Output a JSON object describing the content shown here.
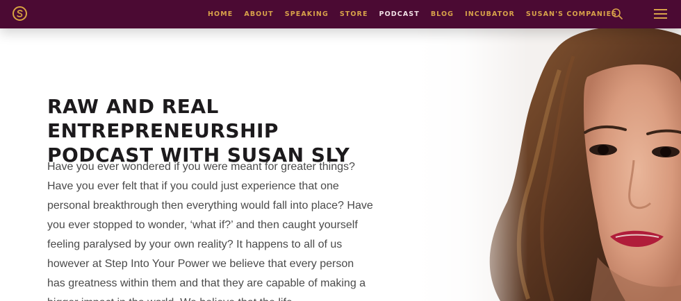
{
  "nav": {
    "logo_icon": "circle-s-logo-icon",
    "items": [
      {
        "label": "HOME",
        "active": false
      },
      {
        "label": "ABOUT",
        "active": false
      },
      {
        "label": "SPEAKING",
        "active": false
      },
      {
        "label": "STORE",
        "active": false
      },
      {
        "label": "PODCAST",
        "active": true
      },
      {
        "label": "BLOG",
        "active": false
      },
      {
        "label": "INCUBATOR",
        "active": false
      },
      {
        "label": "SUSAN'S COMPANIES",
        "active": false
      }
    ],
    "search_icon": "search-icon",
    "menu_icon": "hamburger-menu-icon"
  },
  "hero": {
    "title_line1": "RAW AND REAL ENTREPRENEURSHIP",
    "title_line2": "PODCAST WITH SUSAN SLY",
    "paragraph": "Have you ever wondered if you were meant for greater things? Have you ever felt that if you could just experience that one personal breakthrough then everything would fall into place? Have you ever stopped to wonder, ‘what if?’ and then caught yourself feeling paralysed by your own reality? It happens to all of us however at Step Into Your Power we believe that every person has greatness within them and that they are capable of making a bigger impact in the world. We believe that the life"
  },
  "colors": {
    "nav_bg": "#4b0a33",
    "nav_link": "#d8a24a",
    "nav_active": "#f1e0e6",
    "heading": "#1c1a1c",
    "body": "#4a4a4a"
  }
}
